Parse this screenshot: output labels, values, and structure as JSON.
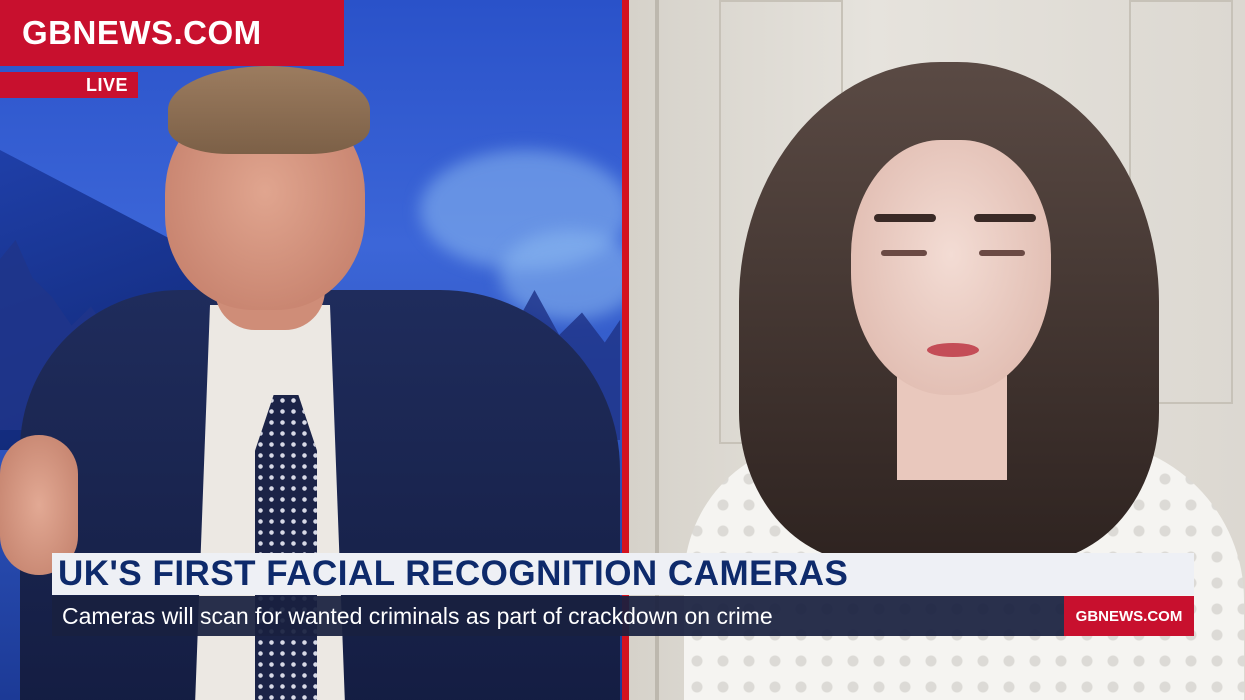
{
  "branding": {
    "site_name": "GBNEWS.COM",
    "live_label": "LIVE",
    "accent_color": "#c8102e"
  },
  "lower_third": {
    "headline": "UK'S FIRST FACIAL RECOGNITION CAMERAS",
    "subheadline": "Cameras will scan for wanted criminals as part of crackdown on crime",
    "brand_tag": "GBNEWS.COM",
    "headline_color": "#0e2a6b"
  }
}
